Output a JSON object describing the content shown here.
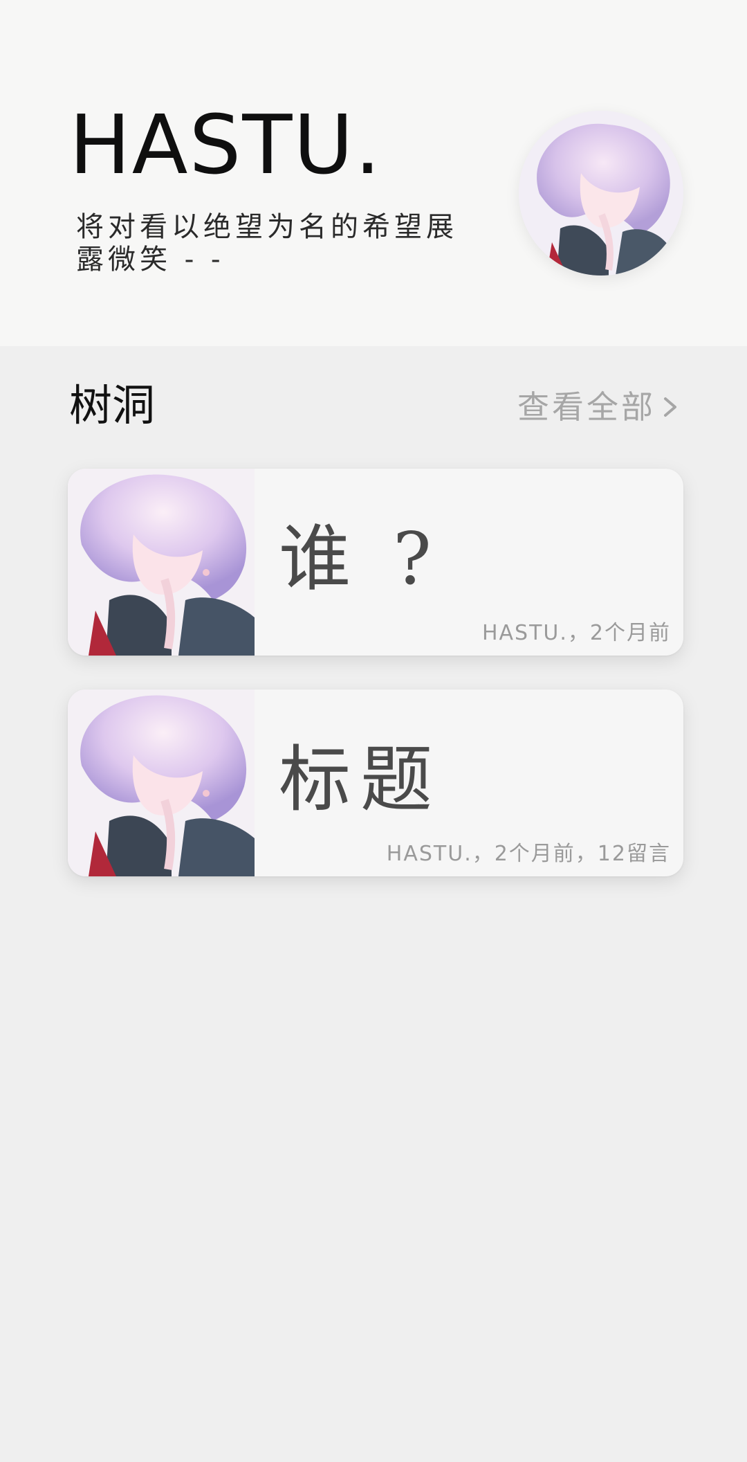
{
  "profile": {
    "name": "HASTU.",
    "tagline": "将对看以绝望为名的希望展露微笑 - -",
    "avatar_icon": "anime-avatar-icon"
  },
  "section": {
    "title": "树洞",
    "view_all": "查看全部"
  },
  "posts": [
    {
      "title": "谁 ?",
      "meta": "HASTU.，2个月前"
    },
    {
      "title": "标题",
      "meta": "HASTU.，2个月前，12留言"
    }
  ]
}
